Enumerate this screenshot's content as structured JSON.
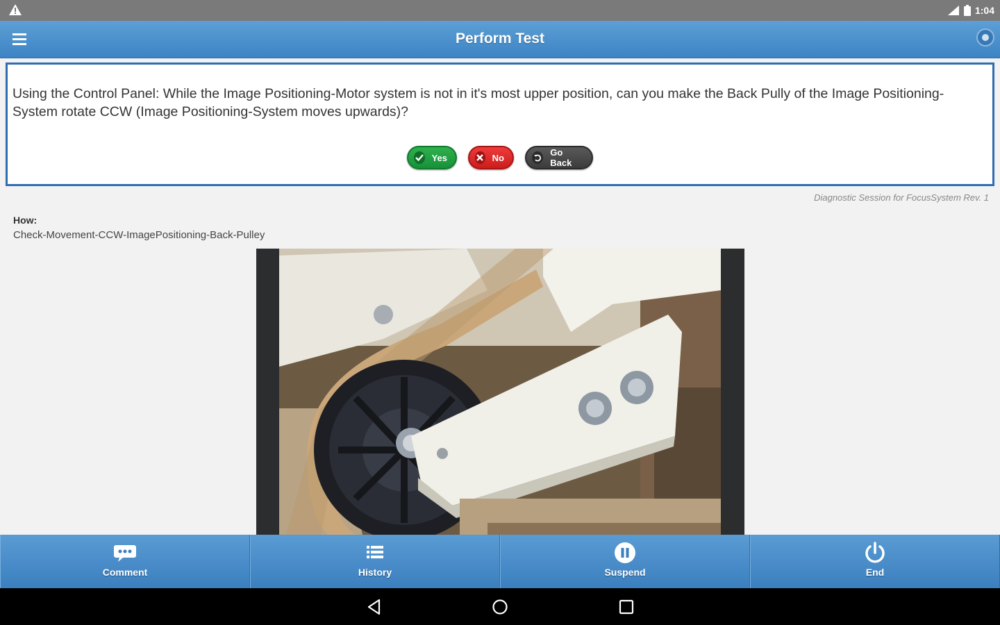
{
  "status_bar": {
    "time": "1:04"
  },
  "app_bar": {
    "title": "Perform Test"
  },
  "question": {
    "text": "Using the Control Panel: While the Image Positioning-Motor system is not in it's most upper position, can you make the Back Pully of the Image Positioning-System rotate CCW (Image Positioning-System moves upwards)?",
    "buttons": {
      "yes": "Yes",
      "no": "No",
      "back": "Go Back"
    }
  },
  "session_label": "Diagnostic Session for FocusSystem Rev. 1",
  "how": {
    "label": "How:",
    "value": "Check-Movement-CCW-ImagePositioning-Back-Pulley"
  },
  "tabs": [
    {
      "label": "Comment",
      "icon": "comment-icon"
    },
    {
      "label": "History",
      "icon": "list-icon"
    },
    {
      "label": "Suspend",
      "icon": "pause-icon"
    },
    {
      "label": "End",
      "icon": "power-icon"
    }
  ],
  "colors": {
    "primary": "#3c84c4",
    "yes": "#1a9a3e",
    "no": "#d42222",
    "back": "#444444"
  }
}
